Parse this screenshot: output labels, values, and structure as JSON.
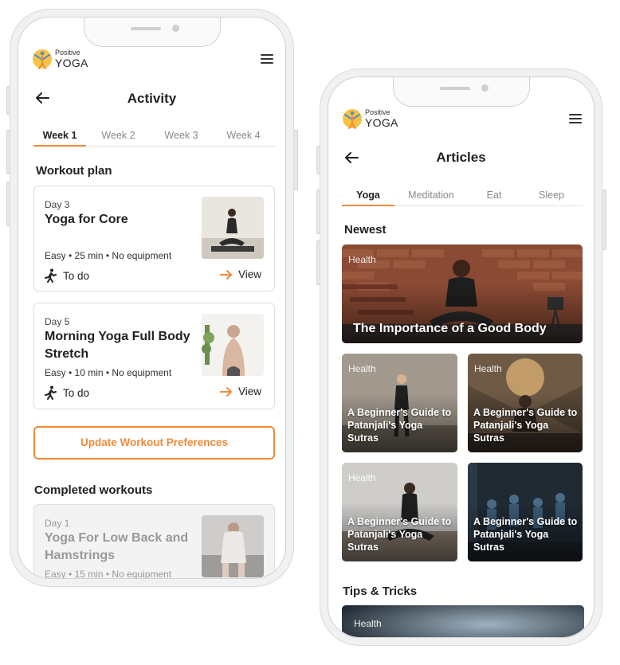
{
  "brand": {
    "small": "Positive",
    "big": "YOGA"
  },
  "activity": {
    "title": "Activity",
    "tabs": [
      {
        "label": "Week 1",
        "active": true
      },
      {
        "label": "Week 2",
        "active": false
      },
      {
        "label": "Week 3",
        "active": false
      },
      {
        "label": "Week 4",
        "active": false
      }
    ],
    "workout_plan_title": "Workout plan",
    "workouts": [
      {
        "day": "Day 3",
        "title": "Yoga for Core",
        "meta": "Easy • 25 min • No equipment",
        "status": "To do",
        "action": "View"
      },
      {
        "day": "Day 5",
        "title": "Morning Yoga Full Body Stretch",
        "meta": "Easy • 10 min • No equipment",
        "status": "To do",
        "action": "View"
      }
    ],
    "update_button": "Update Workout Preferences",
    "completed_title": "Completed workouts",
    "completed": [
      {
        "day": "Day 1",
        "title": "Yoga For Low Back and Hamstrings",
        "meta": "Easy • 15 min • No equipment"
      }
    ]
  },
  "articles": {
    "title": "Articles",
    "tabs": [
      {
        "label": "Yoga",
        "active": true
      },
      {
        "label": "Meditation",
        "active": false
      },
      {
        "label": "Eat",
        "active": false
      },
      {
        "label": "Sleep",
        "active": false
      }
    ],
    "newest_title": "Newest",
    "featured": {
      "tag": "Health",
      "title": "The Importance of a Good Body"
    },
    "grid": [
      {
        "tag": "Health",
        "title": "A Beginner's Guide to Patanjali's Yoga Sutras"
      },
      {
        "tag": "Health",
        "title": "A Beginner's Guide to Patanjali's Yoga Sutras"
      },
      {
        "tag": "Health",
        "title": "A Beginner's Guide to Patanjali's Yoga Sutras"
      },
      {
        "tag": "Health",
        "title": "A Beginner's Guide to Patanjali's Yoga Sutras"
      }
    ],
    "tips_title": "Tips & Tricks",
    "tips": [
      {
        "tag": "Health"
      }
    ]
  },
  "colors": {
    "accent": "#f08a3a",
    "text": "#222222",
    "muted": "#8a8a8a"
  }
}
